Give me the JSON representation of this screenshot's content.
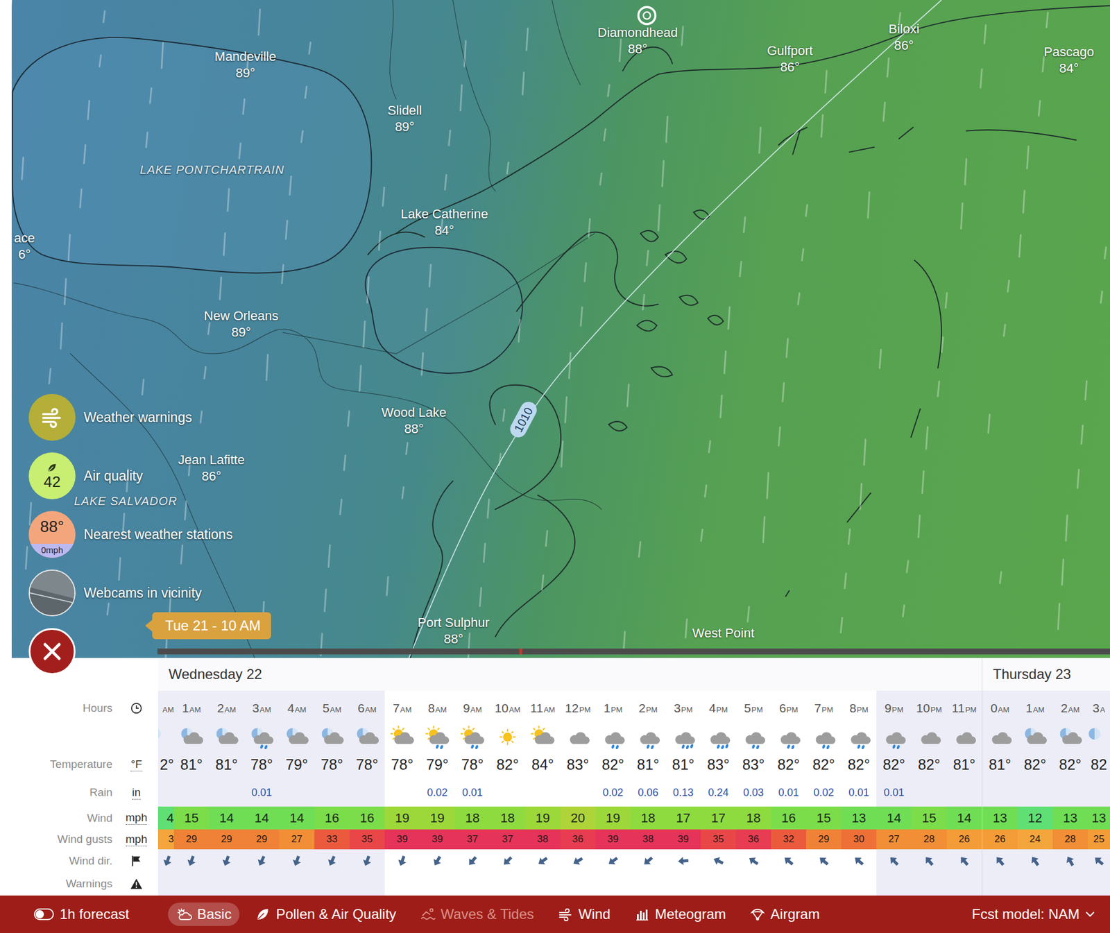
{
  "map": {
    "places": [
      {
        "name": "Mandeville",
        "temp": "89°"
      },
      {
        "name": "Slidell",
        "temp": "89°"
      },
      {
        "name": "Diamondhead",
        "temp": "88°"
      },
      {
        "name": "Gulfport",
        "temp": "86°"
      },
      {
        "name": "Biloxi",
        "temp": "86°"
      },
      {
        "name": "Pascago",
        "temp": "84°"
      },
      {
        "name": "ace",
        "temp": "6°"
      },
      {
        "name": "Lake Catherine",
        "temp": "84°"
      },
      {
        "name": "New Orleans",
        "temp": "89°"
      },
      {
        "name": "Wood Lake",
        "temp": "88°"
      },
      {
        "name": "Jean Lafitte",
        "temp": "86°"
      },
      {
        "name": "Port Sulphur",
        "temp": "88°"
      },
      {
        "name": "West Point",
        "temp": ""
      }
    ],
    "lakes": [
      {
        "name": "LAKE PONTCHARTRAIN"
      },
      {
        "name": "LAKE SALVADOR"
      }
    ],
    "isobar": {
      "label": "1010"
    },
    "timeline": {
      "tooltip": "Tue 21 - 10 AM",
      "level": 0.38
    }
  },
  "side_buttons": [
    {
      "kind": "warnings",
      "label": "Weather warnings",
      "value": "",
      "sub": ""
    },
    {
      "kind": "air",
      "label": "Air quality",
      "value": "42",
      "sub": ""
    },
    {
      "kind": "stations",
      "label": "Nearest weather stations",
      "value": "88°",
      "sub": "0mph"
    },
    {
      "kind": "webcams",
      "label": "Webcams in vicinity",
      "value": "",
      "sub": ""
    },
    {
      "kind": "close",
      "label": "",
      "value": "",
      "sub": ""
    }
  ],
  "forecast": {
    "row_labels": [
      {
        "text": "Hours",
        "kind": "clock",
        "unit": ""
      },
      {
        "text": "Temperature",
        "kind": "unit",
        "unit": "°F"
      },
      {
        "text": "Rain",
        "kind": "unit",
        "unit": "in"
      },
      {
        "text": "Wind",
        "kind": "unit",
        "unit": "mph"
      },
      {
        "text": "Wind gusts",
        "kind": "unit",
        "unit": "mph"
      },
      {
        "text": "Wind dir.",
        "kind": "flag",
        "unit": ""
      },
      {
        "text": "Warnings",
        "kind": "warning",
        "unit": ""
      }
    ],
    "days": [
      {
        "label": "Wednesday 22",
        "hours": [
          {
            "hour": "",
            "suffix": "AM",
            "sky": "moon",
            "temp": "2°",
            "rain": "",
            "wind": "4",
            "gust": "3",
            "dir": 200,
            "night": true
          },
          {
            "hour": "1",
            "suffix": "AM",
            "sky": "night-cloudy",
            "temp": "81°",
            "rain": "",
            "wind": "15",
            "gust": "29",
            "dir": 200,
            "night": true
          },
          {
            "hour": "2",
            "suffix": "AM",
            "sky": "night-cloudy",
            "temp": "81°",
            "rain": "",
            "wind": "14",
            "gust": "29",
            "dir": 200,
            "night": true
          },
          {
            "hour": "3",
            "suffix": "AM",
            "sky": "night-rain",
            "temp": "78°",
            "rain": "0.01",
            "wind": "14",
            "gust": "29",
            "dir": 205,
            "night": true
          },
          {
            "hour": "4",
            "suffix": "AM",
            "sky": "night-cloudy",
            "temp": "79°",
            "rain": "",
            "wind": "14",
            "gust": "27",
            "dir": 200,
            "night": true
          },
          {
            "hour": "5",
            "suffix": "AM",
            "sky": "night-cloudy",
            "temp": "78°",
            "rain": "",
            "wind": "16",
            "gust": "33",
            "dir": 205,
            "night": true
          },
          {
            "hour": "6",
            "suffix": "AM",
            "sky": "night-cloudy",
            "temp": "78°",
            "rain": "",
            "wind": "16",
            "gust": "35",
            "dir": 200,
            "night": true
          },
          {
            "hour": "7",
            "suffix": "AM",
            "sky": "sun-cloud",
            "temp": "78°",
            "rain": "",
            "wind": "19",
            "gust": "39",
            "dir": 200,
            "night": false
          },
          {
            "hour": "8",
            "suffix": "AM",
            "sky": "sun-rain",
            "temp": "79°",
            "rain": "0.02",
            "wind": "19",
            "gust": "39",
            "dir": 210,
            "night": false
          },
          {
            "hour": "9",
            "suffix": "AM",
            "sky": "sun-rain",
            "temp": "78°",
            "rain": "0.01",
            "wind": "18",
            "gust": "37",
            "dir": 220,
            "night": false
          },
          {
            "hour": "10",
            "suffix": "AM",
            "sky": "sun",
            "temp": "82°",
            "rain": "",
            "wind": "18",
            "gust": "37",
            "dir": 225,
            "night": false
          },
          {
            "hour": "11",
            "suffix": "AM",
            "sky": "sun-cloud",
            "temp": "84°",
            "rain": "",
            "wind": "19",
            "gust": "38",
            "dir": 235,
            "night": false
          },
          {
            "hour": "12",
            "suffix": "PM",
            "sky": "cloud",
            "temp": "83°",
            "rain": "",
            "wind": "20",
            "gust": "36",
            "dir": 240,
            "night": false
          },
          {
            "hour": "1",
            "suffix": "PM",
            "sky": "rain",
            "temp": "82°",
            "rain": "0.02",
            "wind": "19",
            "gust": "39",
            "dir": 235,
            "night": false
          },
          {
            "hour": "2",
            "suffix": "PM",
            "sky": "rain",
            "temp": "81°",
            "rain": "0.06",
            "wind": "18",
            "gust": "38",
            "dir": 230,
            "night": false
          },
          {
            "hour": "3",
            "suffix": "PM",
            "sky": "heavy-rain",
            "temp": "81°",
            "rain": "0.13",
            "wind": "17",
            "gust": "39",
            "dir": 265,
            "night": false
          },
          {
            "hour": "4",
            "suffix": "PM",
            "sky": "heavy-rain",
            "temp": "83°",
            "rain": "0.24",
            "wind": "17",
            "gust": "35",
            "dir": 295,
            "night": false
          },
          {
            "hour": "5",
            "suffix": "PM",
            "sky": "rain",
            "temp": "83°",
            "rain": "0.03",
            "wind": "18",
            "gust": "36",
            "dir": 305,
            "night": false
          },
          {
            "hour": "6",
            "suffix": "PM",
            "sky": "rain",
            "temp": "82°",
            "rain": "0.01",
            "wind": "16",
            "gust": "32",
            "dir": 310,
            "night": false
          },
          {
            "hour": "7",
            "suffix": "PM",
            "sky": "rain",
            "temp": "82°",
            "rain": "0.02",
            "wind": "15",
            "gust": "29",
            "dir": 310,
            "night": false
          },
          {
            "hour": "8",
            "suffix": "PM",
            "sky": "rain",
            "temp": "82°",
            "rain": "0.01",
            "wind": "13",
            "gust": "30",
            "dir": 310,
            "night": false
          },
          {
            "hour": "9",
            "suffix": "PM",
            "sky": "rain",
            "temp": "82°",
            "rain": "0.01",
            "wind": "14",
            "gust": "27",
            "dir": 315,
            "night": true
          },
          {
            "hour": "10",
            "suffix": "PM",
            "sky": "cloud",
            "temp": "82°",
            "rain": "",
            "wind": "15",
            "gust": "28",
            "dir": 320,
            "night": true
          },
          {
            "hour": "11",
            "suffix": "PM",
            "sky": "cloud",
            "temp": "81°",
            "rain": "",
            "wind": "14",
            "gust": "26",
            "dir": 320,
            "night": true
          }
        ]
      },
      {
        "label": "Thursday 23",
        "hours": [
          {
            "hour": "0",
            "suffix": "AM",
            "sky": "cloud",
            "temp": "81°",
            "rain": "",
            "wind": "13",
            "gust": "26",
            "dir": 320,
            "night": true
          },
          {
            "hour": "1",
            "suffix": "AM",
            "sky": "night-cloudy",
            "temp": "82°",
            "rain": "",
            "wind": "12",
            "gust": "24",
            "dir": 325,
            "night": true
          },
          {
            "hour": "2",
            "suffix": "AM",
            "sky": "night-cloudy",
            "temp": "82°",
            "rain": "",
            "wind": "13",
            "gust": "28",
            "dir": 330,
            "night": true
          },
          {
            "hour": "3",
            "suffix": "A",
            "sky": "moon",
            "temp": "82",
            "rain": "",
            "wind": "13",
            "gust": "25",
            "dir": 310,
            "night": true
          }
        ]
      }
    ]
  },
  "toolbar": {
    "toggle": {
      "label": "1h forecast",
      "on": false
    },
    "tabs": [
      {
        "label": "Basic",
        "selected": true,
        "disabled": false
      },
      {
        "label": "Pollen & Air Quality",
        "selected": false,
        "disabled": false
      },
      {
        "label": "Waves & Tides",
        "selected": false,
        "disabled": true
      },
      {
        "label": "Wind",
        "selected": false,
        "disabled": false
      },
      {
        "label": "Meteogram",
        "selected": false,
        "disabled": false
      },
      {
        "label": "Airgram",
        "selected": false,
        "disabled": false
      }
    ],
    "model": "Fcst model: NAM"
  }
}
